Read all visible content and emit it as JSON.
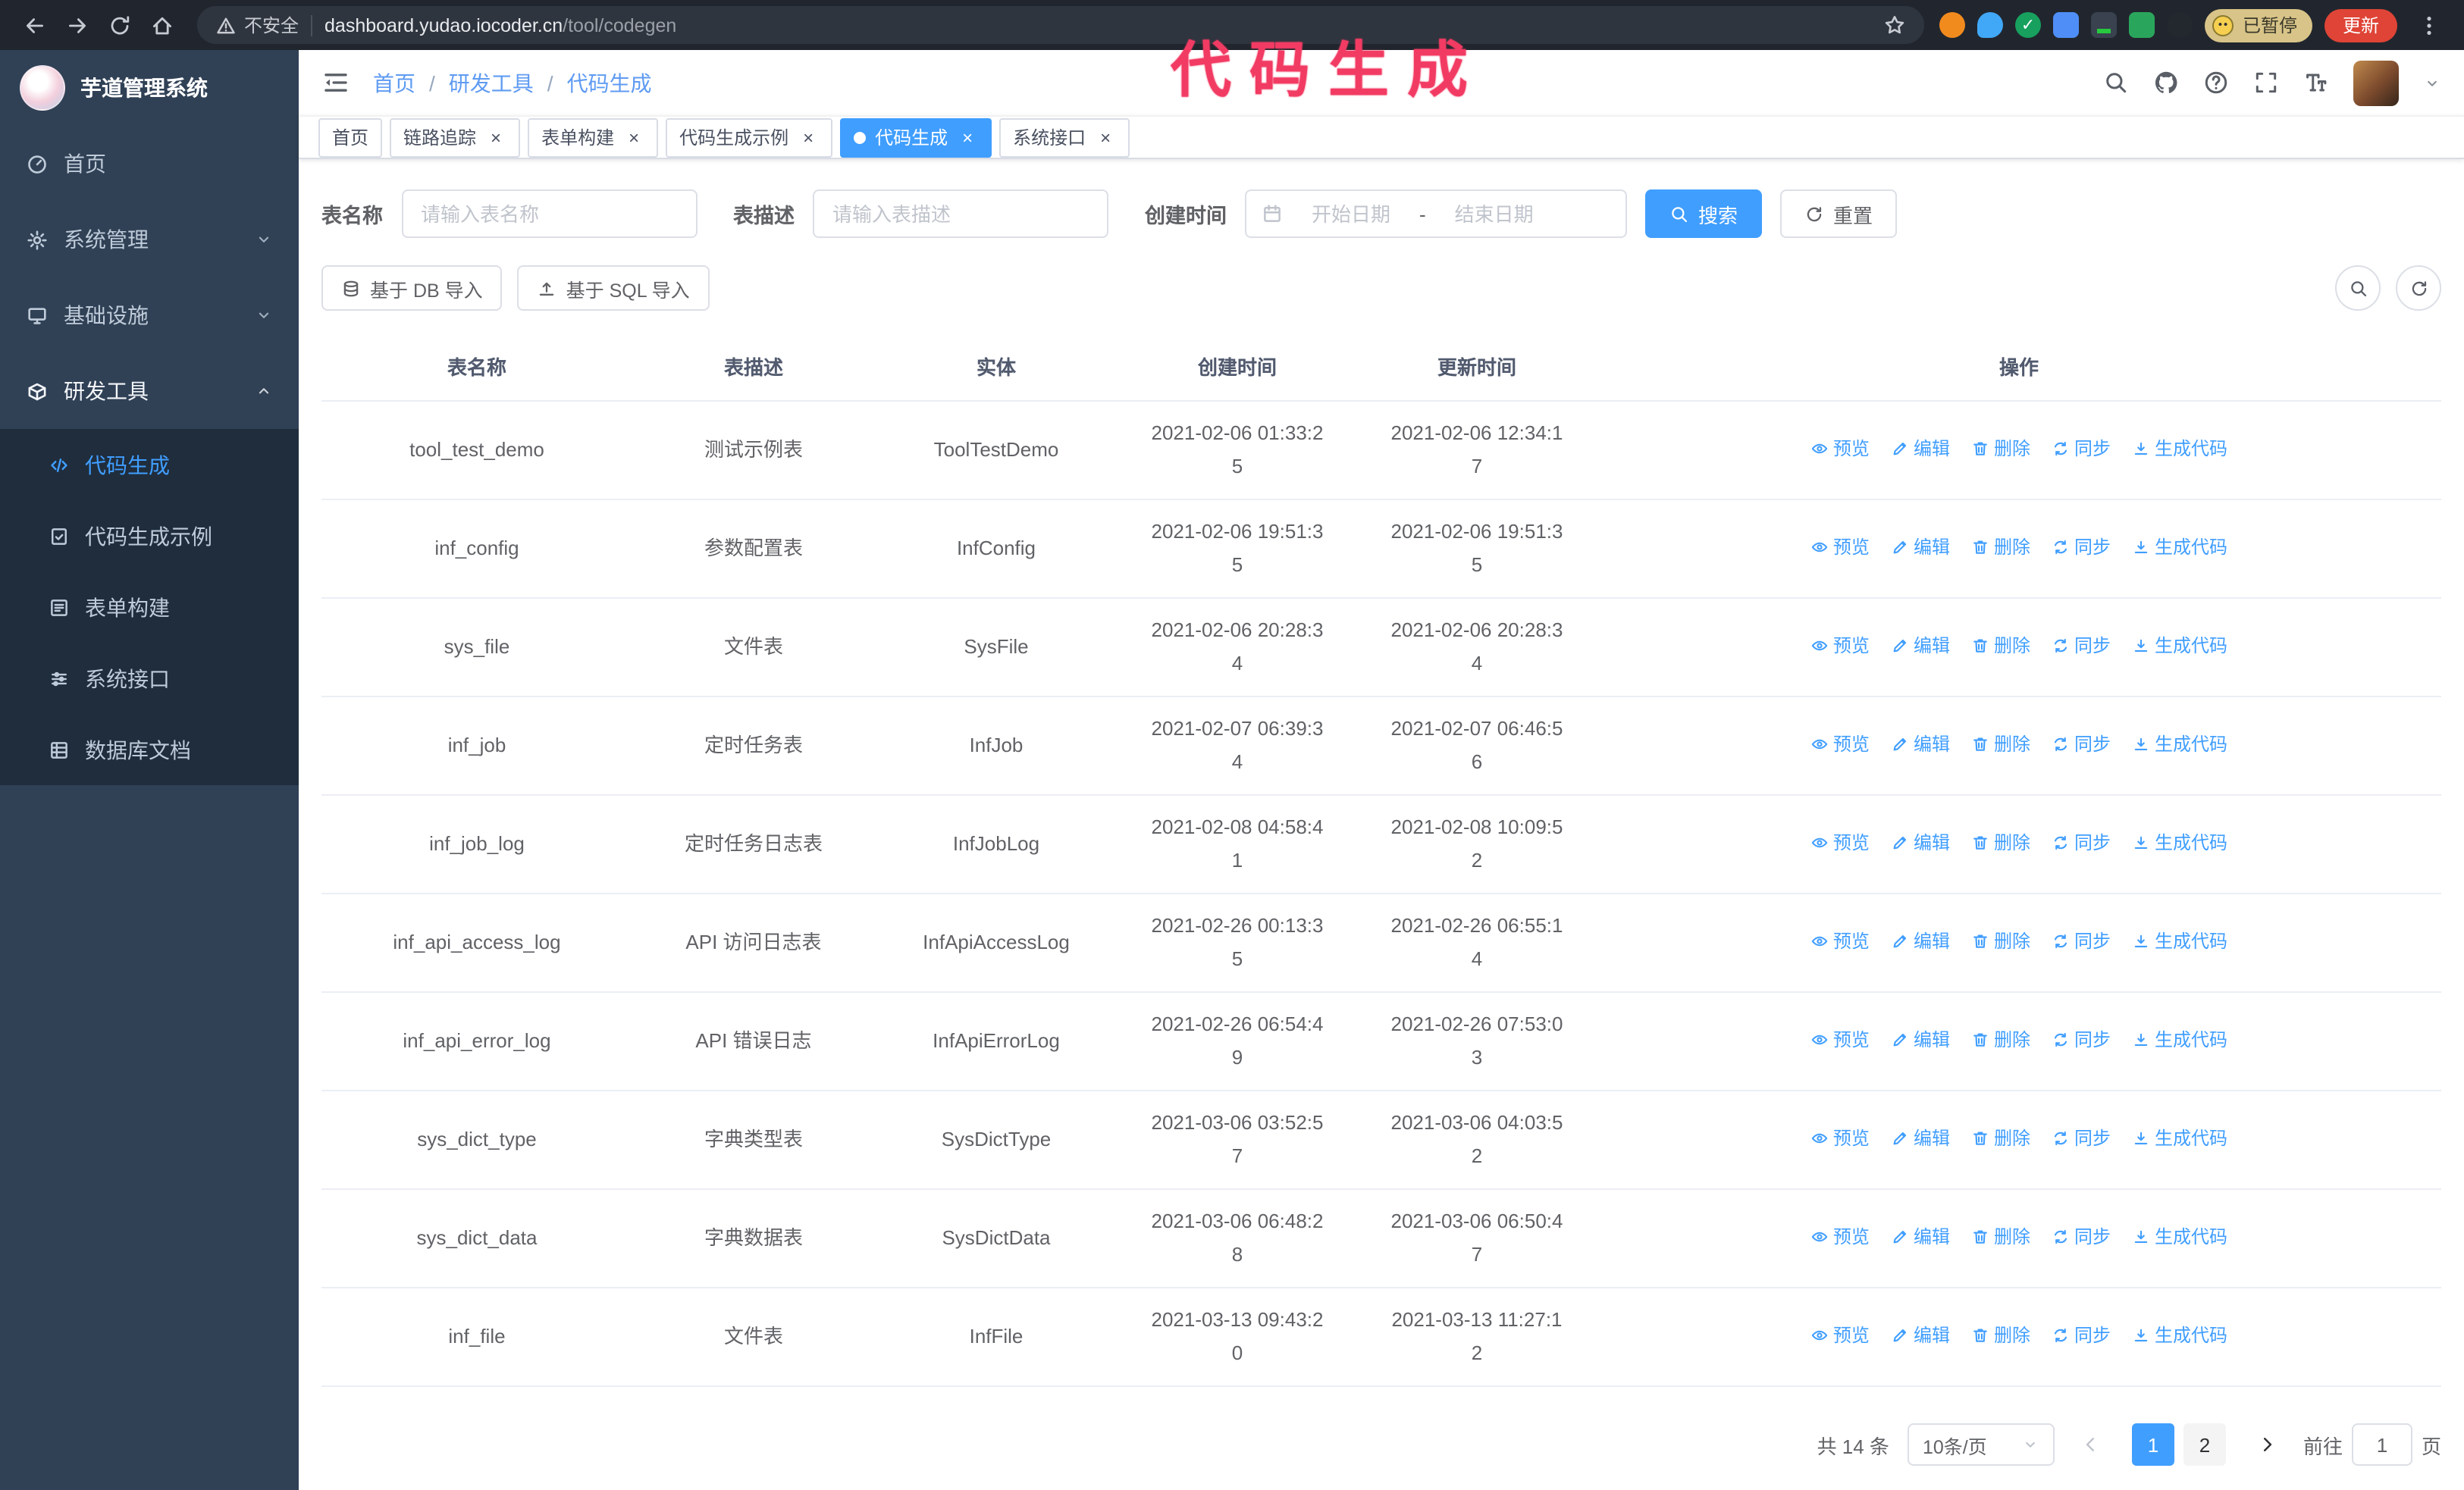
{
  "colors": {
    "accent": "#409eff",
    "sidebar_bg": "#304156",
    "submenu_bg": "#1f2d3d",
    "annotation": "#f23b63",
    "update_button": "#df4436",
    "paused_badge": "#d8c488",
    "chrome_bg": "#21262e"
  },
  "annotation": {
    "text": "代码生成"
  },
  "browser": {
    "security_label": "不安全",
    "url_host": "dashboard.yudao.iocoder.cn",
    "url_path": "/tool/codegen",
    "paused_badge": "已暂停",
    "update_button": "更新"
  },
  "sidebar": {
    "logo_title": "芋道管理系统",
    "menu": [
      {
        "label": "首页",
        "icon": "dashboard"
      },
      {
        "label": "系统管理",
        "icon": "system",
        "expandable": true
      },
      {
        "label": "基础设施",
        "icon": "infra",
        "expandable": true
      },
      {
        "label": "研发工具",
        "icon": "tools",
        "expandable": true,
        "expanded": true,
        "children": [
          {
            "label": "代码生成",
            "icon": "code",
            "active": true
          },
          {
            "label": "代码生成示例",
            "icon": "demo"
          },
          {
            "label": "表单构建",
            "icon": "form"
          },
          {
            "label": "系统接口",
            "icon": "api"
          },
          {
            "label": "数据库文档",
            "icon": "database"
          }
        ]
      }
    ]
  },
  "header": {
    "breadcrumb": [
      "首页",
      "研发工具",
      "代码生成"
    ],
    "breadcrumb_separator": "/"
  },
  "tabs": [
    {
      "label": "首页"
    },
    {
      "label": "链路追踪",
      "closable": true
    },
    {
      "label": "表单构建",
      "closable": true
    },
    {
      "label": "代码生成示例",
      "closable": true
    },
    {
      "label": "代码生成",
      "closable": true,
      "active": true
    },
    {
      "label": "系统接口",
      "closable": true
    }
  ],
  "filters": {
    "table_name_label": "表名称",
    "table_name_placeholder": "请输入表名称",
    "table_desc_label": "表描述",
    "table_desc_placeholder": "请输入表描述",
    "create_time_label": "创建时间",
    "date_start_placeholder": "开始日期",
    "date_separator": "-",
    "date_end_placeholder": "结束日期",
    "search_button": "搜索",
    "reset_button": "重置"
  },
  "toolbar": {
    "import_db_button": "基于 DB 导入",
    "import_sql_button": "基于 SQL 导入"
  },
  "table": {
    "columns": [
      "表名称",
      "表描述",
      "实体",
      "创建时间",
      "更新时间",
      "操作"
    ],
    "action_labels": [
      "预览",
      "编辑",
      "删除",
      "同步",
      "生成代码"
    ],
    "rows": [
      {
        "name": "tool_test_demo",
        "desc": "测试示例表",
        "entity": "ToolTestDemo",
        "created": "2021-02-06 01:33:25",
        "updated": "2021-02-06 12:34:17"
      },
      {
        "name": "inf_config",
        "desc": "参数配置表",
        "entity": "InfConfig",
        "created": "2021-02-06 19:51:35",
        "updated": "2021-02-06 19:51:35"
      },
      {
        "name": "sys_file",
        "desc": "文件表",
        "entity": "SysFile",
        "created": "2021-02-06 20:28:34",
        "updated": "2021-02-06 20:28:34"
      },
      {
        "name": "inf_job",
        "desc": "定时任务表",
        "entity": "InfJob",
        "created": "2021-02-07 06:39:34",
        "updated": "2021-02-07 06:46:56"
      },
      {
        "name": "inf_job_log",
        "desc": "定时任务日志表",
        "entity": "InfJobLog",
        "created": "2021-02-08 04:58:41",
        "updated": "2021-02-08 10:09:52"
      },
      {
        "name": "inf_api_access_log",
        "desc": "API 访问日志表",
        "entity": "InfApiAccessLog",
        "created": "2021-02-26 00:13:35",
        "updated": "2021-02-26 06:55:14"
      },
      {
        "name": "inf_api_error_log",
        "desc": "API 错误日志",
        "entity": "InfApiErrorLog",
        "created": "2021-02-26 06:54:49",
        "updated": "2021-02-26 07:53:03"
      },
      {
        "name": "sys_dict_type",
        "desc": "字典类型表",
        "entity": "SysDictType",
        "created": "2021-03-06 03:52:57",
        "updated": "2021-03-06 04:03:52"
      },
      {
        "name": "sys_dict_data",
        "desc": "字典数据表",
        "entity": "SysDictData",
        "created": "2021-03-06 06:48:28",
        "updated": "2021-03-06 06:50:47"
      },
      {
        "name": "inf_file",
        "desc": "文件表",
        "entity": "InfFile",
        "created": "2021-03-13 09:43:20",
        "updated": "2021-03-13 11:27:12"
      }
    ]
  },
  "pagination": {
    "total_text": "共 14 条",
    "page_size": "10条/页",
    "pages": [
      {
        "label": "1",
        "active": true
      },
      {
        "label": "2"
      }
    ],
    "goto_label": "前往",
    "goto_value": "1",
    "goto_unit": "页"
  }
}
